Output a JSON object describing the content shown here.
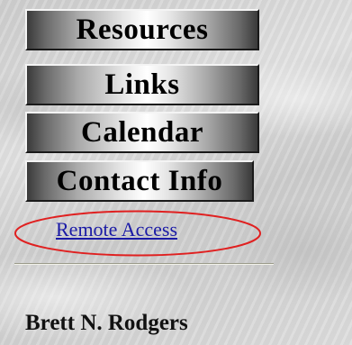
{
  "nav": {
    "resources_label": "Resources",
    "links_label": "Links",
    "calendar_label": "Calendar",
    "contact_label": "Contact Info"
  },
  "remote_access": {
    "label": "Remote Access",
    "highlight_color": "#e02020",
    "link_color": "#1a1aa6"
  },
  "profile": {
    "name": "Brett N. Rodgers"
  }
}
